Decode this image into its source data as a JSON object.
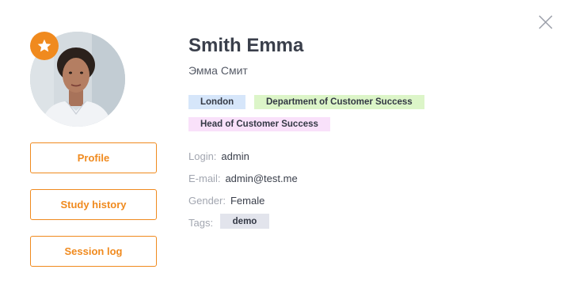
{
  "user": {
    "name": "Smith Emma",
    "name_alt": "Эмма Смит"
  },
  "badges": {
    "city": "London",
    "department": "Department of Customer Success",
    "position": "Head of Customer Success"
  },
  "fields": {
    "login_label": "Login:",
    "login_value": "admin",
    "email_label": "E-mail:",
    "email_value": "admin@test.me",
    "gender_label": "Gender:",
    "gender_value": "Female",
    "tags_label": "Tags:",
    "tags": [
      "demo"
    ]
  },
  "buttons": {
    "profile": "Profile",
    "study_history": "Study history",
    "session_log": "Session log"
  },
  "icons": {
    "close": "close-icon",
    "favorite": "star-icon"
  },
  "colors": {
    "accent": "#f08a1e",
    "city_badge": "#d6e6fa",
    "department_badge": "#dcf5c8",
    "position_badge": "#f9e1fa",
    "tag_badge": "#e2e4ec"
  }
}
